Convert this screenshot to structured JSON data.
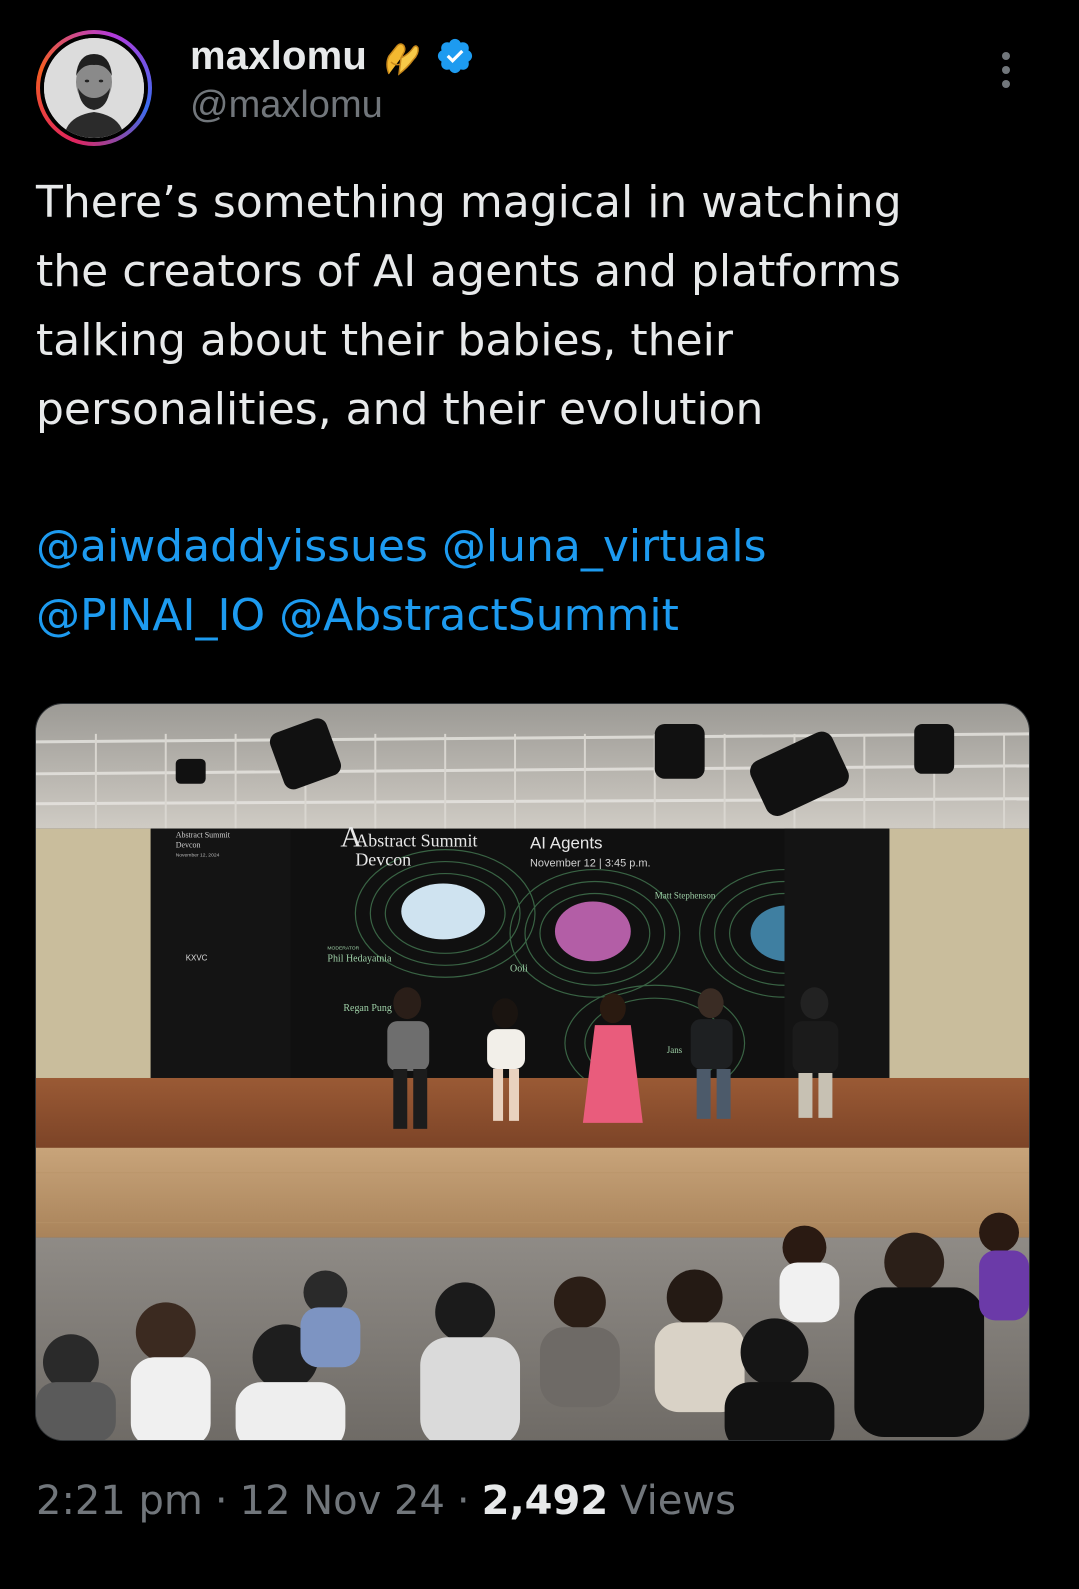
{
  "author": {
    "display_name": "maxlomu",
    "handle": "@maxlomu",
    "badge_emoji": "pinching-hand-icon",
    "verified": true,
    "verified_color": "#1d9bf0"
  },
  "tweet": {
    "lines": [
      "There’s something magical in watching",
      "the creators of AI agents and platforms",
      "talking about their babies, their",
      "personalities, and their evolution"
    ],
    "mentions": [
      "@aiwdaddyissues",
      "@luna_virtuals",
      "@PINAI_IO",
      "@AbstractSummit"
    ]
  },
  "media": {
    "screen": {
      "event_title": "Abstract Summit",
      "event_sub": "Devcon",
      "session_title": "AI Agents",
      "session_time": "November 12 | 3:45 p.m.",
      "moderator_label": "MODERATOR",
      "moderator_name": "Phil Hedayatnia",
      "speaker_1": "Regan Pung",
      "speaker_2": "Ooli",
      "speaker_3": "Matt Stephenson",
      "speaker_4": "Jans",
      "side_title": "Abstract Summit",
      "side_sub": "Devcon",
      "side_date": "November 12, 2024",
      "sponsor": "KXVC"
    }
  },
  "meta": {
    "time": "2:21 pm",
    "separator": "·",
    "date": "12 Nov 24",
    "views_count": "2,492",
    "views_label": "Views"
  },
  "colors": {
    "background": "#000000",
    "text": "#e7e9ea",
    "muted": "#71767b",
    "link": "#1d9bf0"
  }
}
